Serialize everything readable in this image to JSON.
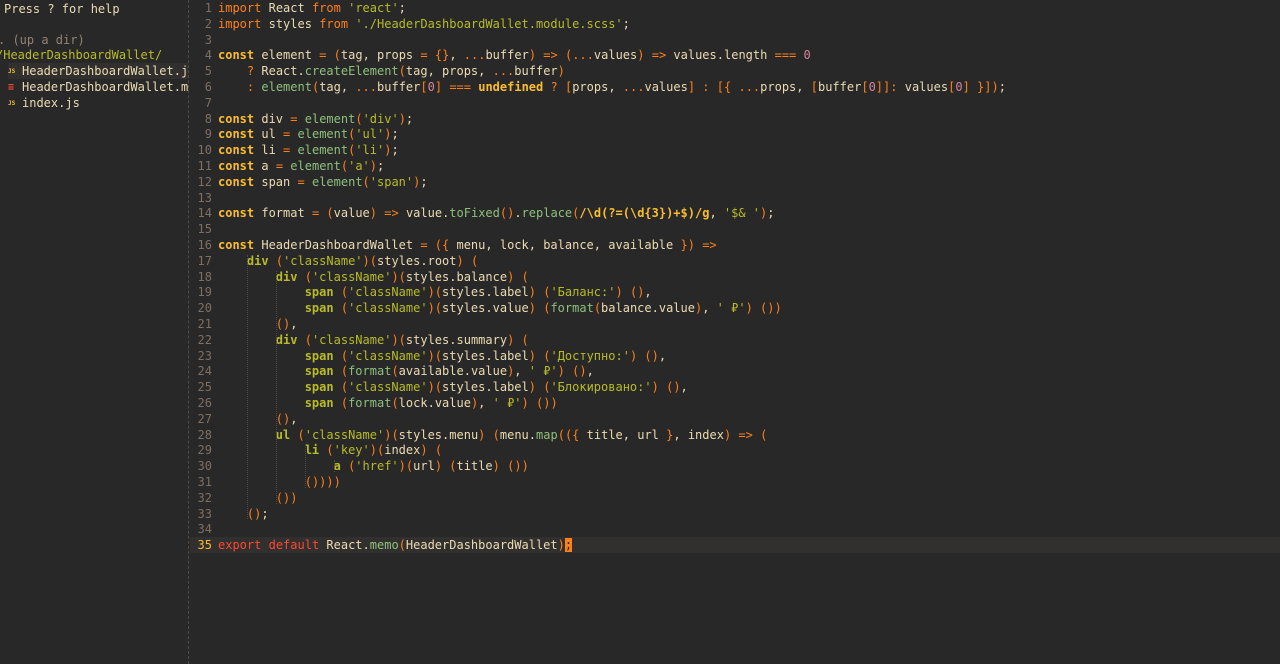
{
  "sidebar": {
    "help": "Press ? for help",
    "up_dir": ". (up a dir)",
    "current_dir": "/HeaderDashboardWallet/",
    "files": [
      {
        "name": "HeaderDashboardWallet.js",
        "icon": "JS",
        "type": "js",
        "selected": true
      },
      {
        "name": "HeaderDashboardWallet.modu",
        "icon": "≡",
        "type": "scss",
        "selected": false
      },
      {
        "name": "index.js",
        "icon": "JS",
        "type": "js",
        "selected": false
      }
    ]
  },
  "editor": {
    "current_line": 35,
    "lines": [
      "import React from 'react';",
      "import styles from './HeaderDashboardWallet.module.scss';",
      "",
      "const element = (tag, props = {}, ...buffer) => (...values) => values.length === 0",
      "    ? React.createElement(tag, props, ...buffer)",
      "    : element(tag, ...buffer[0] === undefined ? [props, ...values] : [{ ...props, [buffer[0]]: values[0] }]);",
      "",
      "const div = element('div');",
      "const ul = element('ul');",
      "const li = element('li');",
      "const a = element('a');",
      "const span = element('span');",
      "",
      "const format = (value) => value.toFixed().replace(/\\d(?=(\\d{3})+$)/g, '$& ');",
      "",
      "const HeaderDashboardWallet = ({ menu, lock, balance, available }) =>",
      "    div ('className')(styles.root) (",
      "        div ('className')(styles.balance) (",
      "            span ('className')(styles.label) ('Баланс:') (),",
      "            span ('className')(styles.value) (format(balance.value), ' ₽') ())",
      "        (),",
      "        div ('className')(styles.summary) (",
      "            span ('className')(styles.label) ('Доступно:') (),",
      "            span (format(available.value), ' ₽') (),",
      "            span ('className')(styles.label) ('Блокировано:') (),",
      "            span (format(lock.value), ' ₽') ())",
      "        (),",
      "        ul ('className')(styles.menu) (menu.map(({ title, url }, index) => (",
      "            li ('key')(index) (",
      "                a ('href')(url) (title) ())",
      "            ())))",
      "        ())",
      "    ();",
      "",
      "export default React.memo(HeaderDashboardWallet);"
    ]
  }
}
